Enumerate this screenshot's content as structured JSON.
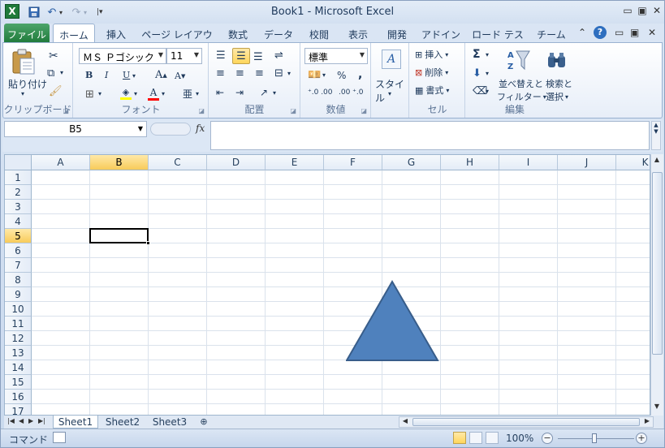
{
  "window": {
    "title": "Book1 - Microsoft Excel"
  },
  "quick_access": {
    "save_icon": "save-icon",
    "undo_icon": "undo-icon",
    "redo_icon": "redo-icon",
    "customize_icon": "customize-icon"
  },
  "tabs": [
    {
      "label": "ファイル"
    },
    {
      "label": "ホーム"
    },
    {
      "label": "挿入"
    },
    {
      "label": "ページ レイアウト"
    },
    {
      "label": "数式"
    },
    {
      "label": "データ"
    },
    {
      "label": "校閲"
    },
    {
      "label": "表示"
    },
    {
      "label": "開発"
    },
    {
      "label": "アドイン"
    },
    {
      "label": "ロード テスト"
    },
    {
      "label": "チーム"
    }
  ],
  "ribbon": {
    "clipboard": {
      "label": "クリップボード",
      "paste": "貼り付け"
    },
    "font": {
      "label": "フォント",
      "font_name": "ＭＳ Ｐゴシック",
      "font_size": "11",
      "bold": "B",
      "italic": "I",
      "underline": "U",
      "grow": "A",
      "shrink": "A",
      "font_color": "A"
    },
    "alignment": {
      "label": "配置"
    },
    "number": {
      "label": "数値",
      "format": "標準",
      "percent": "%",
      "comma": ","
    },
    "styles": {
      "label": "スタイル"
    },
    "cells": {
      "label": "セル",
      "insert": "挿入",
      "delete": "削除",
      "format": "書式"
    },
    "editing": {
      "label": "編集",
      "sum": "Σ",
      "sort_filter_1": "並べ替えと",
      "sort_filter_2": "フィルター",
      "find_select_1": "検索と",
      "find_select_2": "選択"
    }
  },
  "formula_bar": {
    "name_box": "B5",
    "fx": "fx",
    "formula": ""
  },
  "grid": {
    "columns": [
      "A",
      "B",
      "C",
      "D",
      "E",
      "F",
      "G",
      "H",
      "I",
      "J",
      "K"
    ],
    "rows": [
      "1",
      "2",
      "3",
      "4",
      "5",
      "6",
      "7",
      "8",
      "9",
      "10",
      "11",
      "12",
      "13",
      "14",
      "15",
      "16",
      "17"
    ],
    "selected_cell": "B5",
    "shape": {
      "type": "triangle",
      "fill": "#4f81bd",
      "stroke": "#385d8a"
    }
  },
  "sheets": [
    {
      "label": "Sheet1",
      "active": true
    },
    {
      "label": "Sheet2",
      "active": false
    },
    {
      "label": "Sheet3",
      "active": false
    }
  ],
  "status": {
    "mode": "コマンド",
    "zoom": "100%",
    "zoom_out": "−",
    "zoom_in": "+"
  },
  "colors": {
    "accent": "#1f7a3a",
    "selected_header": "#f8cb5a",
    "grid_line": "#dae2ec"
  }
}
